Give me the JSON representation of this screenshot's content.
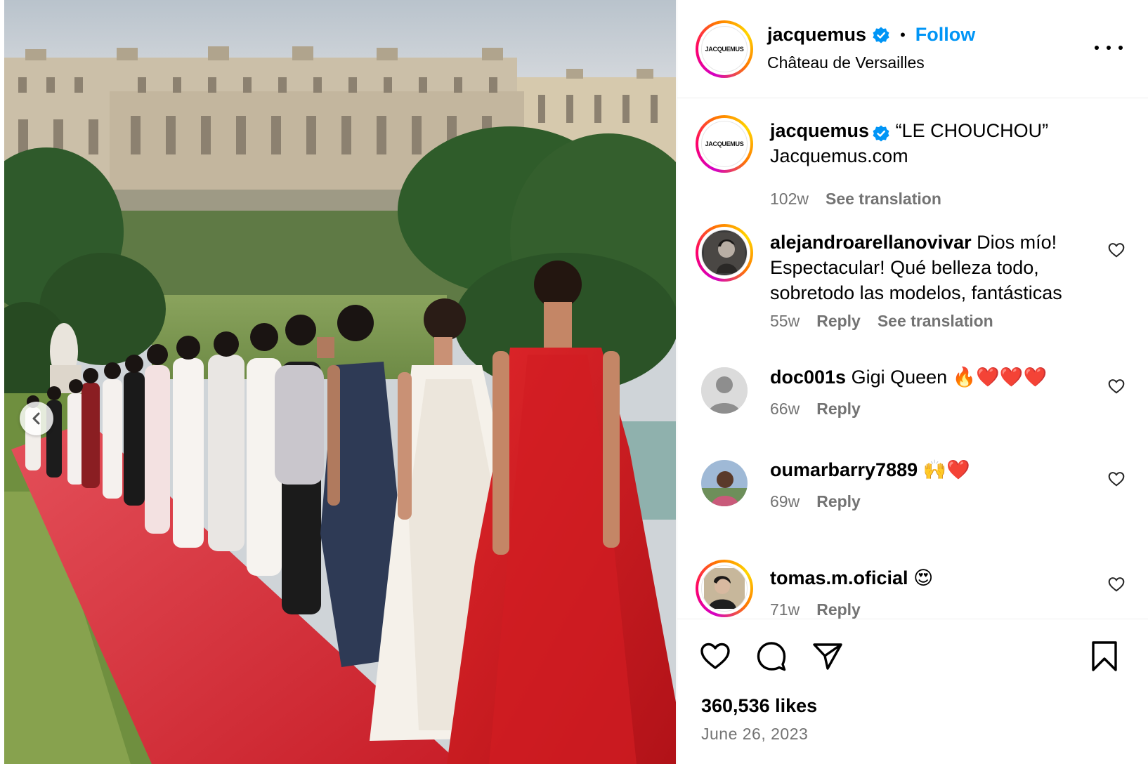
{
  "post": {
    "username": "jacquemus",
    "follow_label": "Follow",
    "separator": "•",
    "location": "Château de Versailles",
    "avatar_logo_text": "JACQUEMUS",
    "verified_icon": "verified-badge-icon",
    "brand_blue": "#0095f6",
    "meta_gray": "#737373"
  },
  "caption": {
    "username": "jacquemus",
    "line1": " “LE CHOUCHOU”",
    "line2": "Jacquemus.com",
    "age": "102w",
    "translate": "See translation"
  },
  "comments": [
    {
      "username": "alejandroarellanovivar",
      "text": " Dios mío! Espectacular! Qué belleza todo, sobretodo las modelos, fantásticas",
      "age": "55w",
      "reply": "Reply",
      "translate": "See translation"
    },
    {
      "username": "doc001s",
      "text": " Gigi Queen 🔥❤️❤️❤️",
      "age": "66w",
      "reply": "Reply"
    },
    {
      "username": "oumarbarry7889",
      "text": " 🙌❤️",
      "age": "69w",
      "reply": "Reply"
    },
    {
      "username": "tomas.m.oficial",
      "text": " 😍",
      "age": "71w",
      "reply": "Reply"
    }
  ],
  "footer": {
    "likes": "360,536 likes",
    "date": "June 26, 2023",
    "icons": [
      "heart-icon",
      "comment-icon",
      "share-icon",
      "bookmark-icon"
    ]
  },
  "photo": {
    "description_icon": "previous-chevron-icon"
  }
}
